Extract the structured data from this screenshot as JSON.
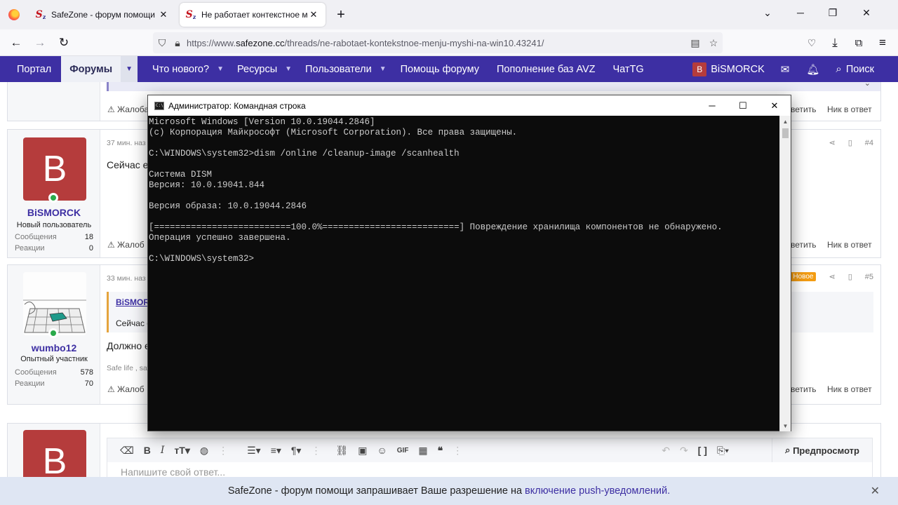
{
  "browser": {
    "tabs": [
      {
        "title": "SafeZone - форум помощи",
        "favicon": "safezone-logo"
      },
      {
        "title": "Не работает контекстное меню",
        "favicon": "safezone-logo"
      }
    ],
    "url_prefix": "https://www.",
    "url_domain": "safezone.cc",
    "url_path": "/threads/ne-rabotaet-kontekstnoe-menju-myshi-na-win10.43241/"
  },
  "site_nav": {
    "items": [
      "Портал",
      "Форумы",
      "Что нового?",
      "Ресурсы",
      "Пользователи",
      "Помощь форуму",
      "Пополнение баз AVZ",
      "ЧатTG"
    ],
    "user": "BiSMORCK",
    "user_initial": "B",
    "search": "Поиск"
  },
  "posts": {
    "top": {
      "report": "Жалоба",
      "reply_partial": "ветить",
      "nick": "Ник в ответ"
    },
    "p4": {
      "avatar_initial": "B",
      "user": "BiSMORCK",
      "title": "Новый пользователь",
      "messages_label": "Сообщения",
      "messages": "18",
      "reactions_label": "Реакции",
      "reactions": "0",
      "time": "37 мин. наз",
      "text": "Сейчас е",
      "report": "Жалоб",
      "reply_partial": "ветить",
      "nick": "Ник в ответ",
      "num": "#4"
    },
    "p5": {
      "user": "wumbo12",
      "title": "Опытный участник",
      "messages_label": "Сообщения",
      "messages": "578",
      "reactions_label": "Реакции",
      "reactions": "70",
      "time": "33 мин. наз",
      "quote_author": "BiSMORC",
      "quote_text": "Сейчас е",
      "text": "Должно е",
      "signature": "Safe life , saf",
      "report": "Жалоб",
      "reply_partial": "ветить",
      "nick": "Ник в ответ",
      "badge": "Новое",
      "num": "#5"
    },
    "reply_avatar_initial": "B"
  },
  "editor": {
    "placeholder": "Напишите свой ответ...",
    "preview": "Предпросмотр"
  },
  "push_bar": {
    "text": "SafeZone - форум помощи запрашивает Ваше разрешение на",
    "link": "включение push-уведомлений."
  },
  "console": {
    "title": "Администратор: Командная строка",
    "icon_text": "C:\\",
    "lines": [
      "Microsoft Windows [Version 10.0.19044.2846]",
      "(c) Корпорация Майкрософт (Microsoft Corporation). Все права защищены.",
      "",
      "C:\\WINDOWS\\system32>dism /online /cleanup-image /scanhealth",
      "",
      "Система DISM",
      "Версия: 10.0.19041.844",
      "",
      "Версия образа: 10.0.19044.2846",
      "",
      "[==========================100.0%==========================] Повреждение хранилища компонентов не обнаружено.",
      "Операция успешно завершена.",
      "",
      "C:\\WINDOWS\\system32>"
    ]
  }
}
